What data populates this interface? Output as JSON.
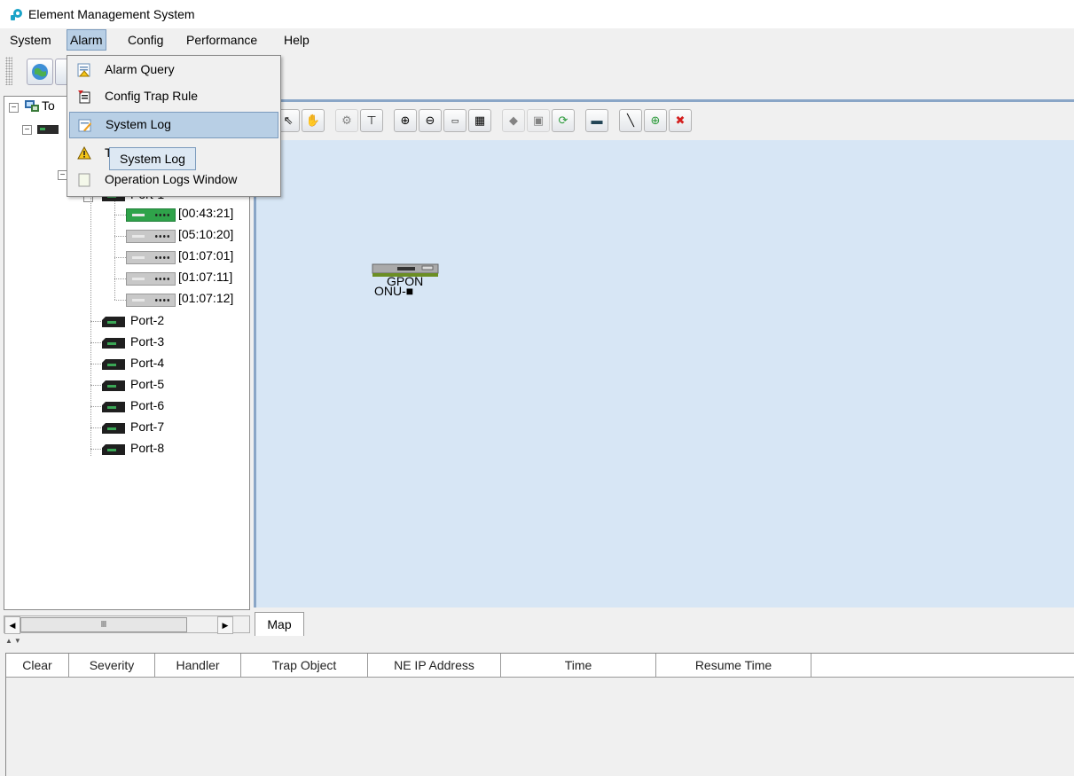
{
  "window": {
    "title": "Element Management System"
  },
  "menubar": {
    "items": [
      {
        "label": "System",
        "u": "S"
      },
      {
        "label": "Alarm",
        "u": "A"
      },
      {
        "label": "Config",
        "u": "C"
      },
      {
        "label": "Performance",
        "u": "P"
      },
      {
        "label": "Help",
        "u": "H"
      }
    ],
    "active": "Alarm"
  },
  "alarm_menu": {
    "items": [
      "Alarm Query",
      "Config Trap Rule",
      "System Log",
      "T",
      "Operation Logs Window"
    ],
    "highlighted": "System Log"
  },
  "tooltip": {
    "text": "System Log"
  },
  "tree": {
    "root_fragment": "To",
    "port1_fragment": "Port-1",
    "onus": [
      "[00:43:21]",
      "[05:10:20]",
      "[01:07:01]",
      "[01:07:11]",
      "[01:07:12]"
    ],
    "ports": [
      "Port-2",
      "Port-3",
      "Port-4",
      "Port-5",
      "Port-6",
      "Port-7",
      "Port-8"
    ],
    "scroll_thumb_glyph": "Ⅲ"
  },
  "map": {
    "tab_label": "Map",
    "node": {
      "label_line1": "GPON",
      "label_line2": "ONU-■"
    }
  },
  "alarm_table": {
    "columns": [
      "Clear",
      "Severity",
      "Handler",
      "Trap Object",
      "NE IP Address",
      "Time",
      "Resume Time"
    ],
    "rows": []
  },
  "colors": {
    "map_bg": "#d7e6f5",
    "highlight": "#b8cfe5",
    "onu_selected": "#2fa34a"
  }
}
